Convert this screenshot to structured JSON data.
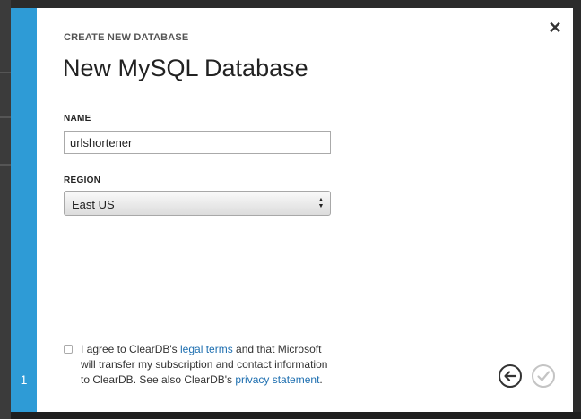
{
  "dialog": {
    "subtitle": "CREATE NEW DATABASE",
    "title": "New MySQL Database",
    "close_glyph": "✕",
    "step_number": "1"
  },
  "form": {
    "name_label": "NAME",
    "name_value": "urlshortener",
    "region_label": "REGION",
    "region_value": "East US"
  },
  "agreement": {
    "text_1": "I agree to ClearDB's ",
    "legal_link": "legal terms",
    "text_2": " and that Microsoft will transfer my subscription and contact information to ClearDB. See also ClearDB's ",
    "privacy_link": "privacy statement",
    "text_3": "."
  },
  "icons": {
    "close": "close-icon",
    "back": "back-arrow-icon",
    "confirm": "checkmark-icon",
    "select_arrows": "updown-arrows-icon"
  },
  "colors": {
    "step_bar": "#2e9bd6",
    "link": "#1e6fb0"
  }
}
